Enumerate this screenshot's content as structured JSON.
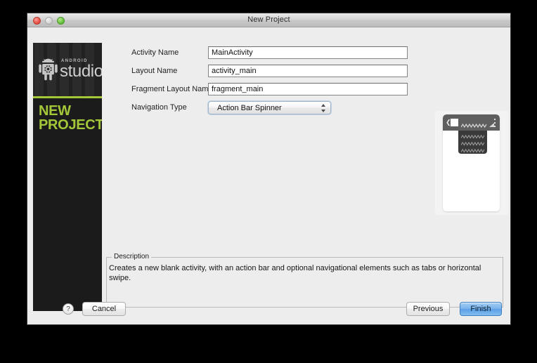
{
  "window": {
    "title": "New Project",
    "traffic_lights": [
      "close",
      "minimize",
      "zoom"
    ]
  },
  "sidebar": {
    "brand_small": "ANDROID",
    "brand_large": "studio",
    "headline_line1": "NEW",
    "headline_line2": "PROJECT",
    "accent_color": "#a4c639",
    "background_color": "#1b1b1b"
  },
  "form": {
    "rows": [
      {
        "label": "Activity Name",
        "value": "MainActivity",
        "type": "text"
      },
      {
        "label": "Layout Name",
        "value": "activity_main",
        "type": "text"
      },
      {
        "label": "Fragment Layout Name",
        "value": "fragment_main",
        "type": "text"
      },
      {
        "label": "Navigation Type",
        "value": "Action Bar Spinner",
        "type": "combo"
      }
    ]
  },
  "preview": {
    "name": "action-bar-spinner-preview",
    "action_bar_color": "#5f5f5f",
    "spinner_panel_color": "#3a3a3a",
    "screen_color": "#ffffff",
    "back_glyph": "❮",
    "spinner_rows": 3
  },
  "description": {
    "legend": "Description",
    "text": "Creates a new blank activity, with an action bar and optional navigational elements such as tabs or horizontal swipe."
  },
  "footer": {
    "help_label": "?",
    "cancel_label": "Cancel",
    "previous_label": "Previous",
    "finish_label": "Finish",
    "finish_color": "#5ba1e6"
  }
}
